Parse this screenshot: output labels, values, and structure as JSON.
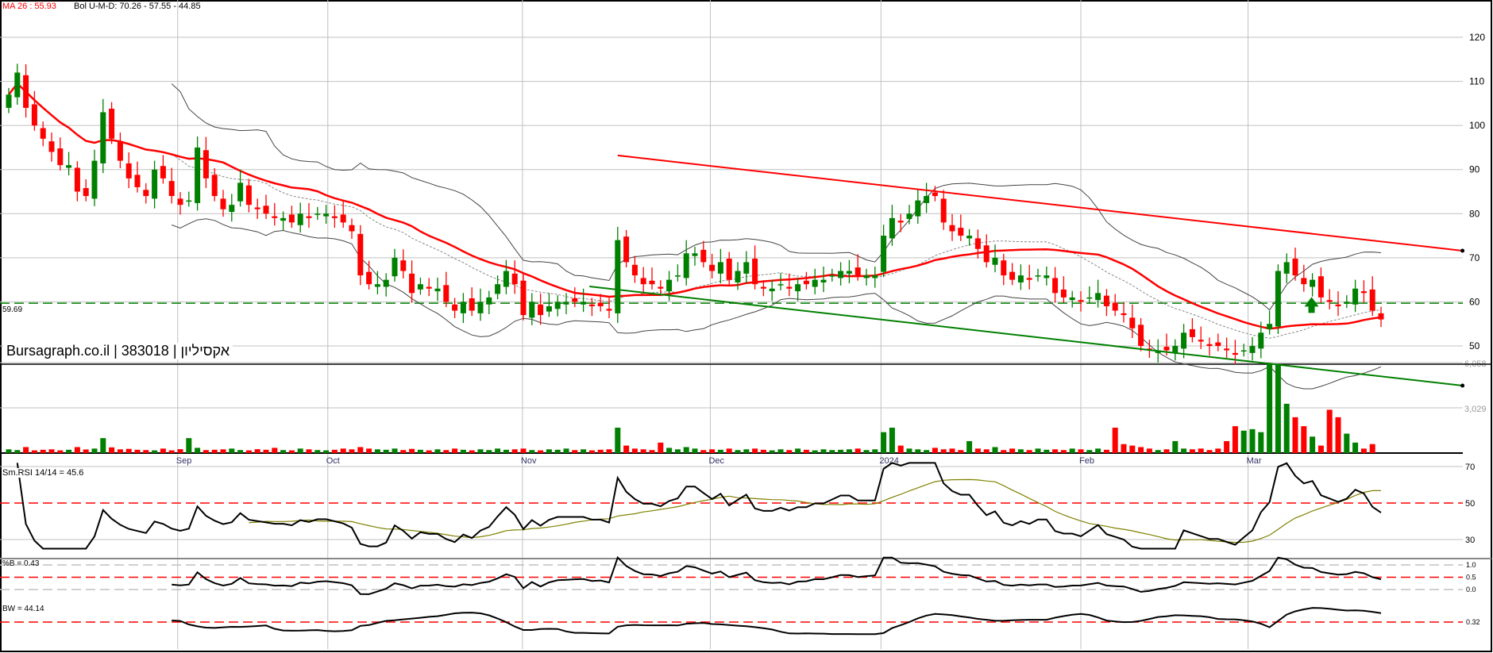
{
  "header": {
    "ma_label": "MA 26 : 55.93",
    "bol_label": "Bol U-M-D: 70.26 - 57.55 - 44.85"
  },
  "watermark": "Bursagraph.co.il | 383018 | אקסיליון",
  "colors": {
    "up": "#008000",
    "down": "#ff0000",
    "ma": "#ff0000",
    "rsi_ma": "#808000",
    "grid": "#c0c0c0"
  },
  "chart_data": {
    "type": "candlestick",
    "months": [
      {
        "label": "Sep",
        "index": 19.7
      },
      {
        "label": "Oct",
        "index": 37.2
      },
      {
        "label": "Nov",
        "index": 59.9
      },
      {
        "label": "Dec",
        "index": 81.8
      },
      {
        "label": "2024",
        "index": 101.7
      },
      {
        "label": "Feb",
        "index": 125.0
      },
      {
        "label": "Mar",
        "index": 144.5
      }
    ],
    "price_axis": {
      "ticks": [
        50,
        60,
        70,
        80,
        90,
        100,
        110,
        120
      ],
      "range": [
        50,
        120
      ]
    },
    "close": [
      107,
      112,
      104,
      100,
      97,
      94,
      91,
      91,
      85,
      84,
      92,
      103,
      97,
      92,
      88,
      86,
      84,
      90,
      88,
      84,
      82,
      83,
      95,
      88,
      84,
      81,
      82,
      87,
      82,
      81,
      80,
      79,
      79,
      78,
      80,
      79,
      80,
      80,
      79,
      78,
      76,
      66,
      64,
      64,
      65,
      70,
      67,
      62,
      64,
      63,
      63,
      60,
      58,
      60,
      58,
      60,
      61,
      64,
      67,
      64,
      57,
      60,
      57,
      59,
      60,
      60,
      60,
      60,
      59,
      59,
      58,
      74,
      69,
      66,
      64,
      64,
      63,
      65,
      66,
      71,
      71,
      69,
      67,
      69,
      65,
      67,
      69,
      64,
      63,
      63,
      64,
      63,
      64,
      64,
      65,
      65,
      66,
      67,
      67,
      66,
      66,
      66,
      75,
      79,
      78,
      80,
      83,
      84,
      84,
      78,
      76,
      75,
      75,
      72,
      69,
      70,
      66,
      65,
      66,
      65,
      66,
      66,
      62,
      61,
      61,
      60,
      61,
      62,
      59,
      58,
      57,
      54,
      50,
      49,
      49,
      49,
      50,
      53,
      52,
      51,
      50,
      50,
      49,
      48,
      49,
      50,
      53,
      55,
      67,
      69,
      66,
      64,
      65,
      61,
      60,
      59,
      60,
      63,
      62,
      58,
      56
    ],
    "volume": [
      250,
      200,
      400,
      180,
      220,
      250,
      180,
      220,
      400,
      240,
      300,
      1000,
      380,
      250,
      280,
      220,
      200,
      180,
      300,
      180,
      260,
      1000,
      350,
      200,
      220,
      250,
      300,
      200,
      180,
      260,
      220,
      350,
      200,
      180,
      300,
      250,
      200,
      180,
      220,
      300,
      250,
      400,
      300,
      250,
      220,
      300,
      200,
      280,
      220,
      180,
      250,
      200,
      300,
      220,
      180,
      250,
      200,
      300,
      220,
      250,
      300,
      200,
      180,
      250,
      220,
      300,
      200,
      250,
      180,
      220,
      250,
      1700,
      500,
      300,
      250,
      200,
      700,
      350,
      250,
      400,
      300,
      200,
      250,
      220,
      300,
      200,
      250,
      300,
      220,
      180,
      250,
      200,
      300,
      220,
      180,
      250,
      200,
      220,
      250,
      300,
      200,
      250,
      1400,
      1700,
      500,
      300,
      250,
      200,
      350,
      250,
      300,
      200,
      800,
      300,
      250,
      400,
      200,
      300,
      250,
      200,
      300,
      220,
      250,
      200,
      300,
      250,
      200,
      300,
      220,
      1700,
      600,
      500,
      400,
      300,
      200,
      250,
      800,
      300,
      250,
      300,
      200,
      300,
      800,
      1800,
      1500,
      1600,
      1400,
      6200,
      6200,
      3300,
      2400,
      1800,
      1100,
      500,
      2900,
      2400,
      1300,
      700,
      300,
      600
    ],
    "volume_axis": {
      "ticks": [
        "6,058",
        "3,029"
      ]
    },
    "support_level": {
      "value": 59.69,
      "label": "59.69"
    },
    "trendlines": [
      {
        "name": "resistance",
        "color": "#ff0000",
        "from": [
          71,
          93.2
        ],
        "to": [
          169.5,
          71.6
        ]
      },
      {
        "name": "support",
        "color": "#008000",
        "from": [
          67.7,
          63.5
        ],
        "to": [
          169.5,
          41.0
        ]
      }
    ],
    "signal_arrow": {
      "index": 151.9,
      "price": 57.5,
      "direction": "up"
    },
    "indicators": {
      "ma_period": 26,
      "bollinger_period": 20,
      "rsi": {
        "label": "Sm.RSI 14/14 = 45.6",
        "ticks": [
          "70",
          "50",
          "30"
        ]
      },
      "percent_b": {
        "label": "%B = 0.43",
        "ticks": [
          "1.0",
          "0.5",
          "0.0"
        ]
      },
      "bandwidth": {
        "label": "BW = 44.14",
        "ticks": [
          "0.32"
        ]
      }
    }
  }
}
